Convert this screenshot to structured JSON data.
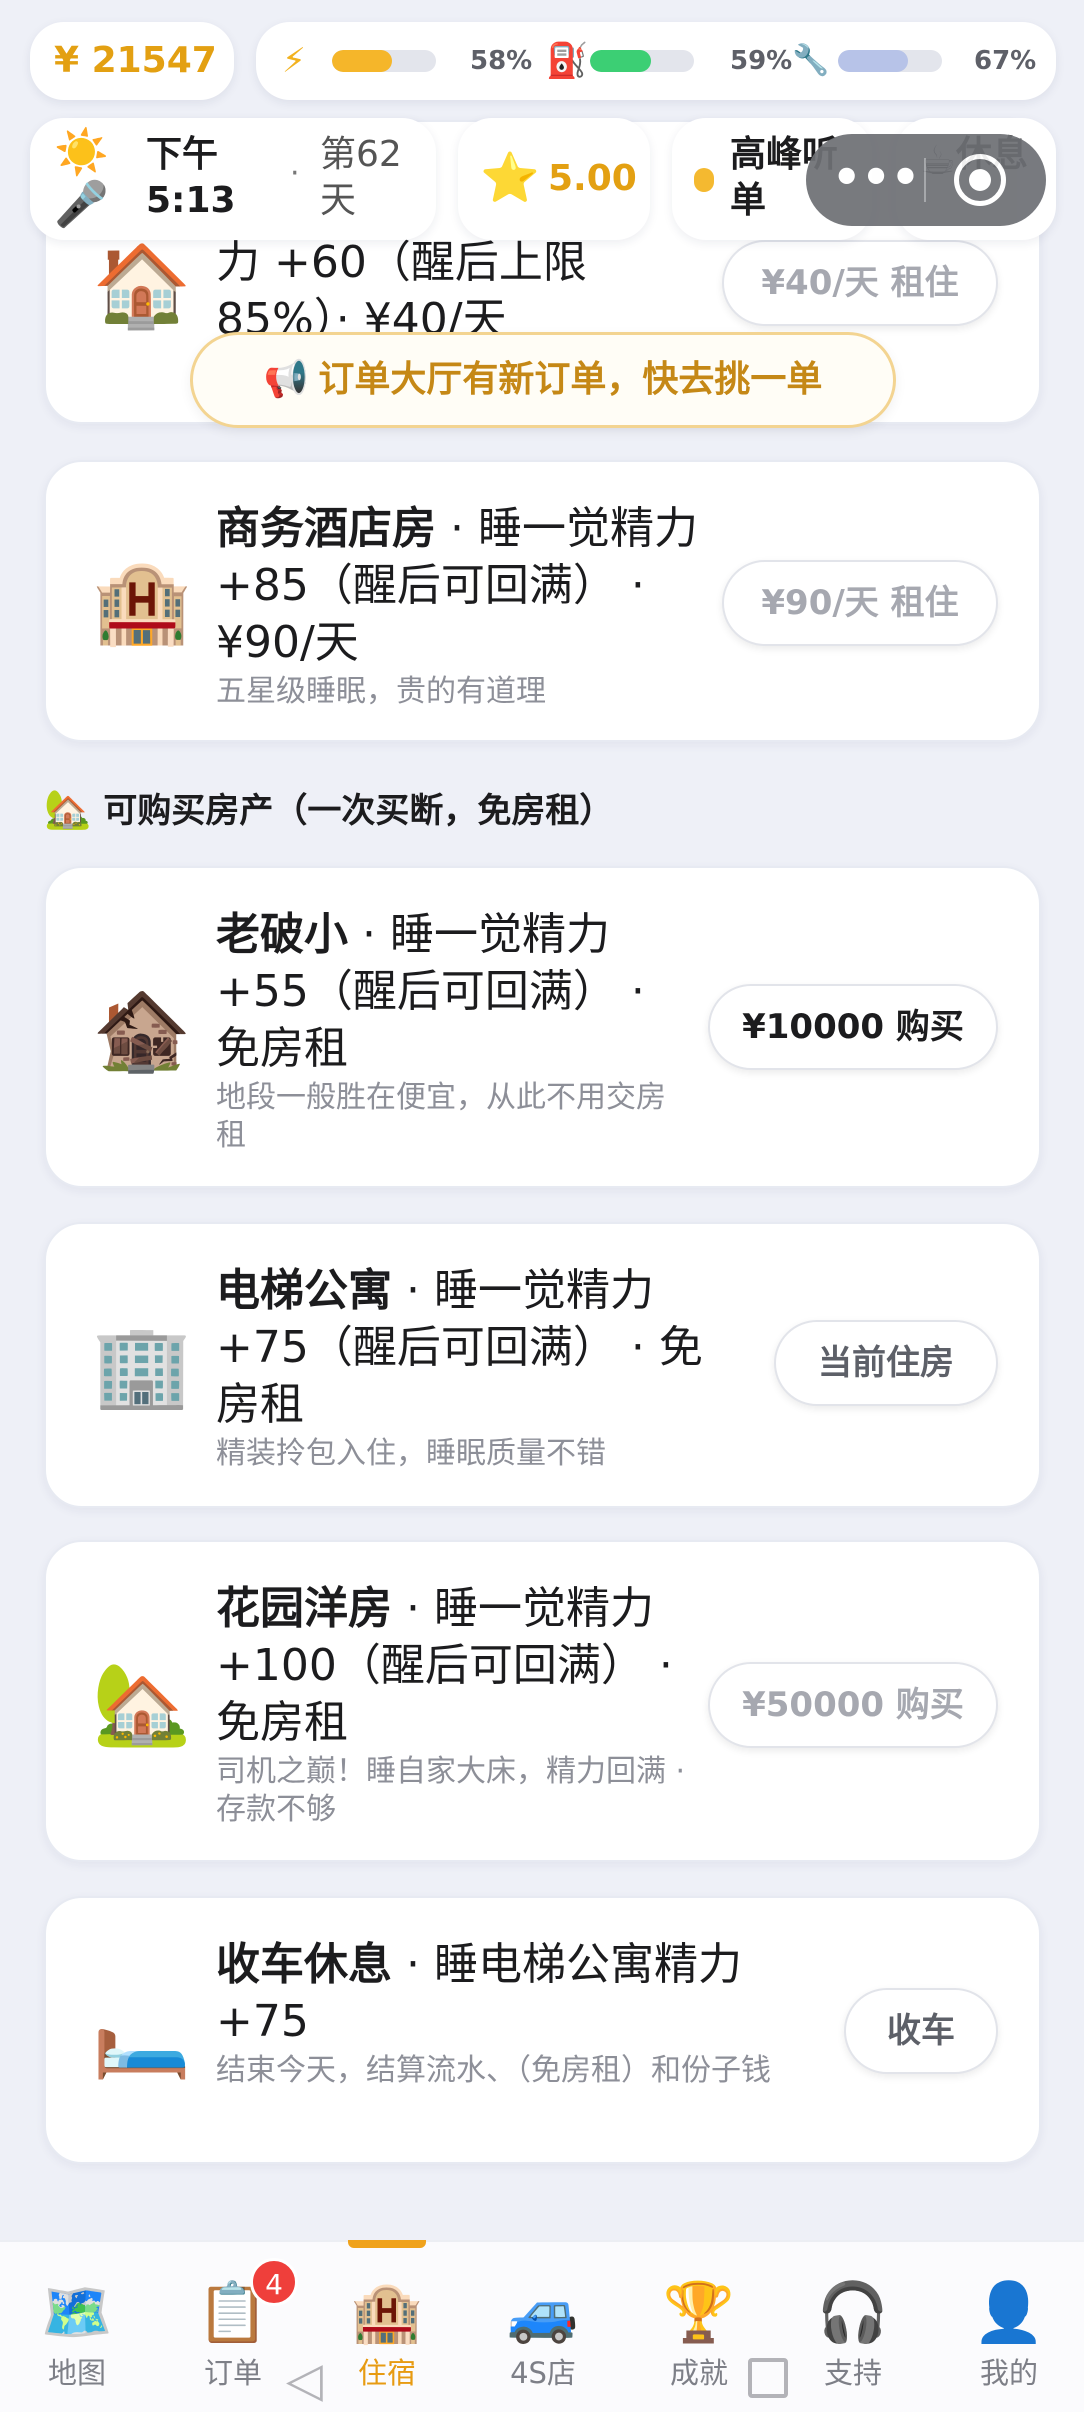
{
  "status": {
    "money": "¥ 21547",
    "energy_pct": "58%",
    "energy_level": 0.58,
    "fuel_pct": "59%",
    "fuel_level": 0.59,
    "condition_pct": "67%",
    "condition_level": 0.67,
    "time_period": "下午",
    "time": "5:13",
    "day": "第62天",
    "rating": "5.00",
    "order_mode": "高峰听单",
    "rest_label": "休息"
  },
  "top_fragment": {
    "title_line": "力 +60（醒后上限85%）· ¥40/天",
    "button": "¥40/天 租住"
  },
  "toast": "订单大厅有新订单，快去挑一单",
  "rent_cards": [
    {
      "name": "商务酒店房",
      "effect": " · 睡一觉精力 +85（醒后可回满） · ¥90/天",
      "desc": "五星级睡眠，贵的有道理",
      "button": "¥90/天 租住"
    }
  ],
  "buy_section_title": "可购买房产（一次买断，免房租）",
  "buy_cards": [
    {
      "name": "老破小",
      "effect": " · 睡一觉精力 +55（醒后可回满） · 免房租",
      "desc": "地段一般胜在便宜，从此不用交房租",
      "button": "¥10000 购买"
    },
    {
      "name": "电梯公寓",
      "effect": " · 睡一觉精力 +75（醒后可回满） · 免房租",
      "desc": "精装拎包入住，睡眠质量不错",
      "button": "当前住房"
    },
    {
      "name": "花园洋房",
      "effect": " · 睡一觉精力 +100（醒后可回满） · 免房租",
      "desc": "司机之巅！睡自家大床，精力回满 · 存款不够",
      "button": "¥50000 购买"
    }
  ],
  "end_card": {
    "name": "收车休息",
    "effect": " · 睡电梯公寓精力 +75",
    "desc": "结束今天，结算流水、（免房租）和份子钱",
    "button": "收车"
  },
  "tabs": [
    {
      "label": "地图",
      "icon": "map-icon"
    },
    {
      "label": "订单",
      "icon": "clipboard-icon"
    },
    {
      "label": "住宿",
      "icon": "hotel-icon"
    },
    {
      "label": "4S店",
      "icon": "car-icon"
    },
    {
      "label": "成就",
      "icon": "trophy-icon"
    },
    {
      "label": "支持",
      "icon": "headphones-icon"
    },
    {
      "label": "我的",
      "icon": "person-icon"
    }
  ],
  "order_badge": "4",
  "colors": {
    "accent": "#e79b12",
    "background": "#eef0f7",
    "energy": "#f5b62a",
    "fuel": "#3ccf74",
    "condition": "#b7c3e8"
  }
}
